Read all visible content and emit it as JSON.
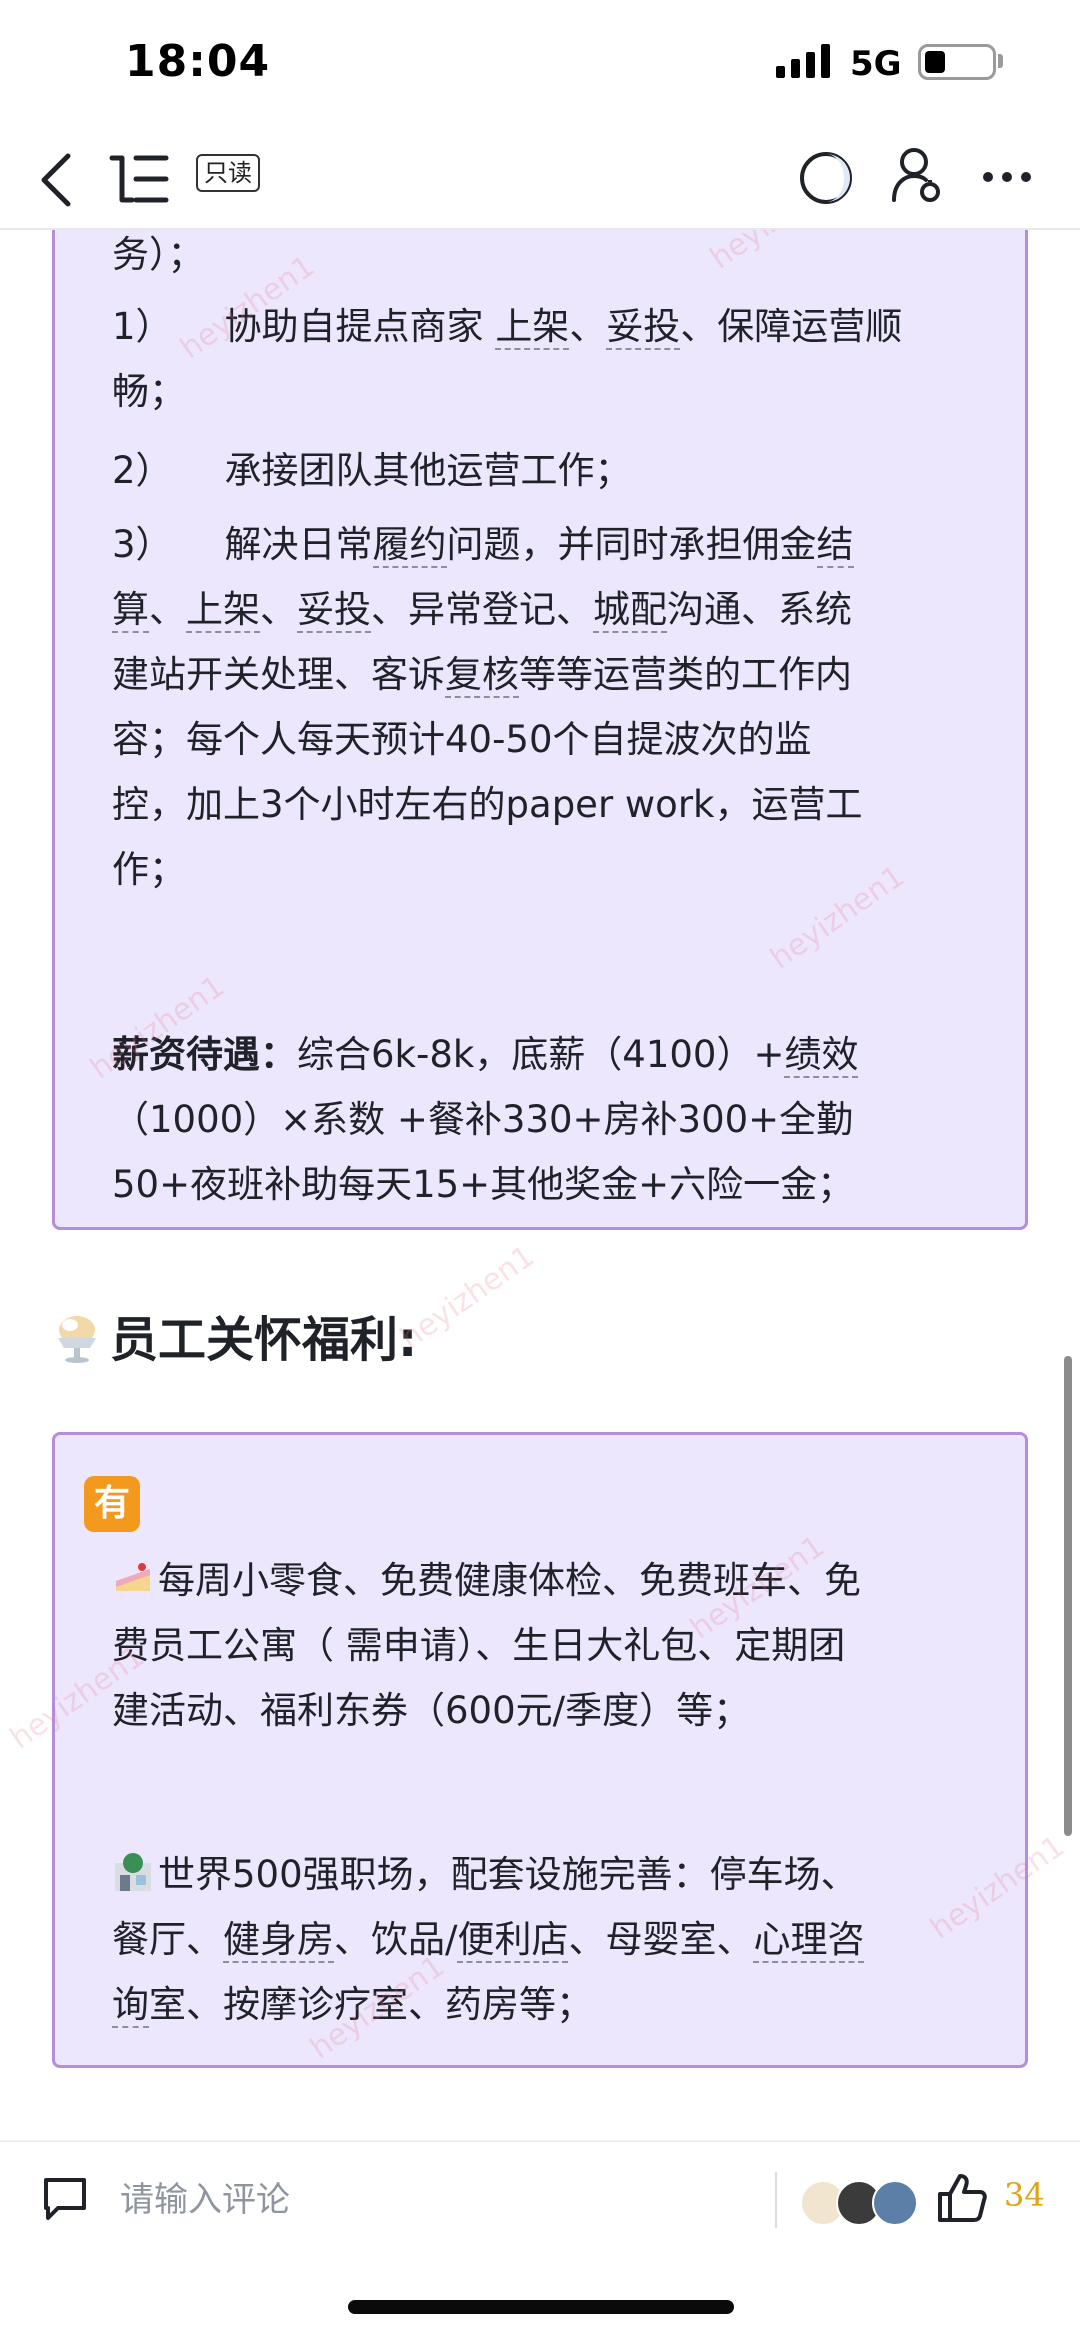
{
  "status_bar": {
    "time": "18:04",
    "network": "5G",
    "battery_level": 0.3
  },
  "nav": {
    "readonly_label": "只读"
  },
  "card1": {
    "continued": "务）；",
    "items": [
      {
        "num": "1）",
        "parts": [
          "协助自提点商家 ",
          "上架",
          "、",
          "妥投",
          "、保障运营顺",
          "畅；"
        ]
      },
      {
        "num": "2）",
        "text": "承接团队其他运营工作；"
      }
    ],
    "item3_num": "3）",
    "item3_a": "解决日常",
    "item3_b": "履约",
    "item3_c": "问题，并同时承担佣金",
    "item3_d": "结",
    "item3_e": "算",
    "item3_f": "、",
    "item3_g": "上架",
    "item3_h": "、",
    "item3_i": "妥投",
    "item3_j": "、异常登记、",
    "item3_k": "城配",
    "item3_l": "沟通、系统",
    "item3_m": "建站开关处理、客诉",
    "item3_n": "复核",
    "item3_o": "等等运营类的工作内",
    "item3_p": "容；每个人每天预计40-50个自提波次的监",
    "item3_q": "控，加上3个小时左右的paper work，运营工",
    "item3_r": "作；",
    "salary_label": "薪资待遇：",
    "salary_a": "综合6k-8k，底薪（4100）+",
    "salary_b": "绩效",
    "salary_c": "（1000）×系数 +餐补330+房补300+全勤",
    "salary_d": "50+夜班补助每天15+其他奖金+六险一金；"
  },
  "section": {
    "title": "员工关怀福利:"
  },
  "card2": {
    "tag": "有",
    "p1_a": "每周小零食、免费健康体检、免费班车、免",
    "p1_b": "费员工公寓（ 需申请）、生日大礼包、定期团",
    "p1_c": "建活动、福利东券（600元/季度）等；",
    "p2_a": "世界500强职场，配套设施完善：停车场、",
    "p2_b1": "餐厅、",
    "p2_b2": "健身房",
    "p2_b3": "、饮品/",
    "p2_b4": "便利店",
    "p2_b5": "、母婴室、",
    "p2_b6": "心理咨",
    "p2_c1": "询",
    "p2_c2": "室、按摩诊疗室、药房等；"
  },
  "watermark": "heyizhen1",
  "bottom": {
    "comment_placeholder": "请输入评论",
    "like_count": "34"
  },
  "colors": {
    "card_bg": "#ede7fd",
    "card_border": "#b48ddb",
    "like": "#e0a317",
    "tag": "#f39a1e"
  }
}
